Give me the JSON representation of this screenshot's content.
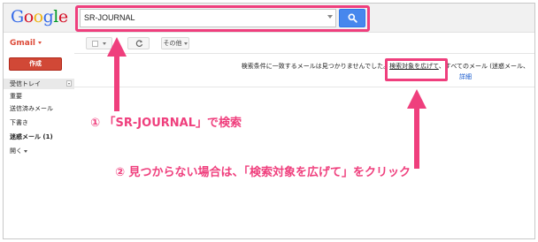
{
  "brand": {
    "logo_letters": [
      {
        "ch": "G",
        "color": "#3369e8"
      },
      {
        "ch": "o",
        "color": "#d50f25"
      },
      {
        "ch": "o",
        "color": "#eeb211"
      },
      {
        "ch": "g",
        "color": "#3369e8"
      },
      {
        "ch": "l",
        "color": "#009925"
      },
      {
        "ch": "e",
        "color": "#d50f25"
      }
    ]
  },
  "search": {
    "value": "SR-JOURNAL",
    "button_icon": "search-icon"
  },
  "app": {
    "gmail_label": "Gmail"
  },
  "toolbar": {
    "more_label": "その他",
    "refresh_icon": "refresh-icon"
  },
  "sidebar": {
    "compose_label": "作成",
    "items": [
      {
        "label": "受信トレイ",
        "active": true
      },
      {
        "label": "重要"
      },
      {
        "label": "送信済みメール"
      },
      {
        "label": "下書き"
      },
      {
        "label": "迷惑メール (1)",
        "bold": true
      },
      {
        "label": "開く"
      }
    ]
  },
  "main": {
    "message_prefix": "検索条件に一致するメールは見つかりませんでした。",
    "widen_link": "検索対象を広げて",
    "message_suffix": "、すべてのメール (迷惑メール、",
    "details_link": "詳細"
  },
  "annotations": {
    "step1": "① 「SR-JOURNAL」で検索",
    "step2": "② 見つからない場合は、「検索対象を広げて」をクリック"
  },
  "colors": {
    "accent": "#ef3f7d",
    "compose": "#d14836",
    "search_button": "#4787ed",
    "link": "#1155cc"
  }
}
